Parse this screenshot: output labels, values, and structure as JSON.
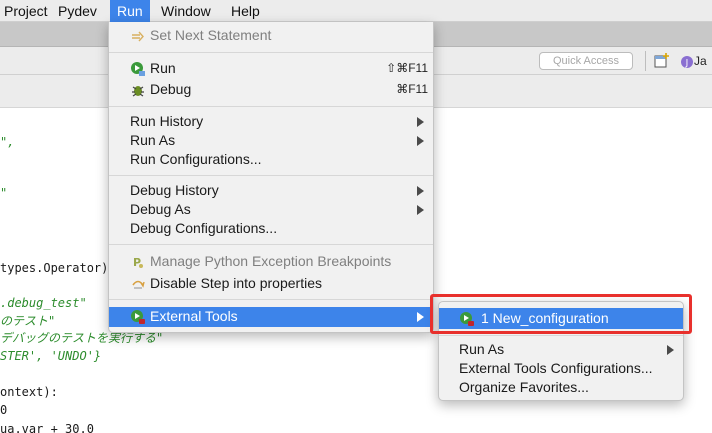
{
  "menubar": {
    "items": [
      "Project",
      "Pydev",
      "Run",
      "Window",
      "Help"
    ],
    "active_index": 2
  },
  "toolbar": {
    "quick_access_placeholder": "Quick Access",
    "perspective_label": "Ja"
  },
  "editor": {
    "lines": [
      {
        "text": "\",",
        "kind": "str"
      },
      {
        "text": "\"",
        "kind": "str"
      },
      {
        "text": "types.Operator):",
        "kind": "plain"
      },
      {
        "text": ".debug_test\"",
        "kind": "str"
      },
      {
        "text": "のテスト\"",
        "kind": "str"
      },
      {
        "text": "デバッグのテストを実行する\"",
        "kind": "str"
      },
      {
        "text": "STER', 'UNDO'}",
        "kind": "mixed"
      },
      {
        "text": "ontext):",
        "kind": "plain"
      },
      {
        "text": "0",
        "kind": "plain"
      },
      {
        "text": "ua.var + 30.0",
        "kind": "plain"
      }
    ]
  },
  "run_menu": {
    "set_next_statement": "Set Next Statement",
    "run": "Run",
    "run_shortcut": "⇧⌘F11",
    "debug": "Debug",
    "debug_shortcut": "⌘F11",
    "run_history": "Run History",
    "run_as": "Run As",
    "run_configurations": "Run Configurations...",
    "debug_history": "Debug History",
    "debug_as": "Debug As",
    "debug_configurations": "Debug Configurations...",
    "manage_breakpoints": "Manage Python Exception Breakpoints",
    "disable_step": "Disable Step into properties",
    "external_tools": "External Tools"
  },
  "external_tools_submenu": {
    "new_configuration": "1 New_configuration",
    "run_as": "Run As",
    "configurations": "External Tools Configurations...",
    "organize_favorites": "Organize Favorites..."
  },
  "colors": {
    "highlight": "#3d84ea",
    "annotation_box": "#e8302c"
  }
}
